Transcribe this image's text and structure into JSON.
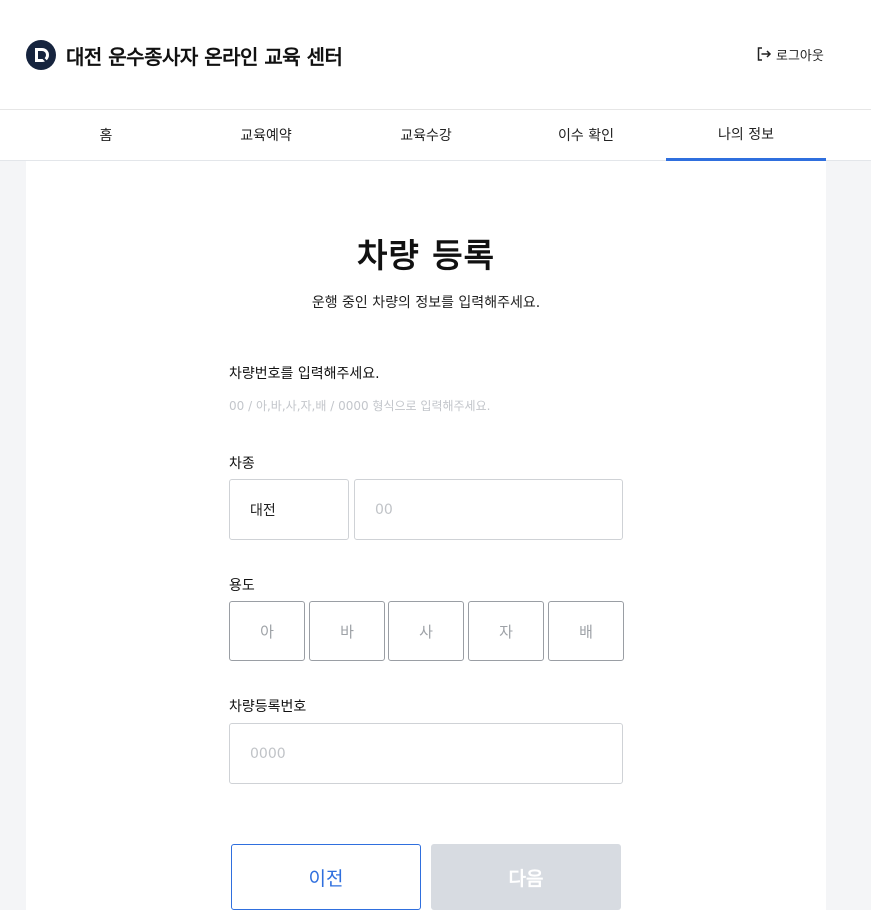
{
  "header": {
    "title": "대전 운수종사자 온라인 교육 센터",
    "logout_label": "로그아웃"
  },
  "nav": {
    "tabs": [
      "홈",
      "교육예약",
      "교육수강",
      "이수 확인",
      "나의 정보"
    ],
    "active_tab": "나의 정보"
  },
  "page": {
    "title": "차량 등록",
    "subtitle": "운행 중인 차량의 정보를 입력해주세요."
  },
  "form": {
    "plate_label": "차량번호를 입력해주세요.",
    "plate_hint": "00 / 아,바,사,자,배 / 0000 형식으로 입력해주세요.",
    "vehicle_type": {
      "label": "차종",
      "region_value": "대전",
      "number_placeholder": "00"
    },
    "usage": {
      "label": "용도",
      "options": [
        "아",
        "바",
        "사",
        "자",
        "배"
      ]
    },
    "registration": {
      "label": "차량등록번호",
      "placeholder": "0000"
    }
  },
  "buttons": {
    "prev": "이전",
    "next": "다음"
  },
  "colors": {
    "accent": "#2f6fde",
    "disabled": "#d7dbe1",
    "logo": "#16243e"
  }
}
